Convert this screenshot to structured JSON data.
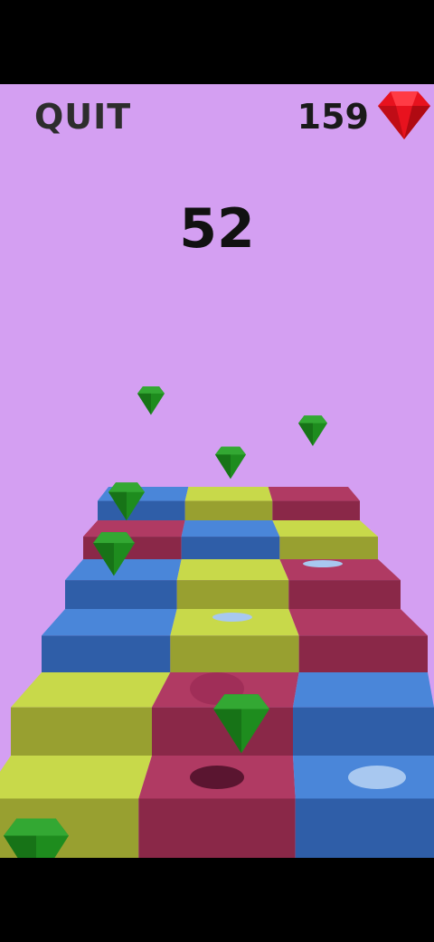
{
  "hud": {
    "quit_label": "QUIT",
    "gem_count": "159",
    "score": "52",
    "gem_icon": "red-diamond-icon"
  },
  "colors": {
    "background": "#d49ff2",
    "yellow_top": "#c8d94a",
    "yellow_side": "#98a030",
    "red_top": "#b03a63",
    "red_side": "#8a2848",
    "blue_top": "#4a86d9",
    "blue_side": "#2f5ea8",
    "gem_green": "#1e8c1e",
    "gem_red": "#e8121e"
  },
  "stairs": {
    "rows": [
      [
        "yellow",
        "red",
        "blue"
      ],
      [
        "yellow",
        "red",
        "blue"
      ],
      [
        "blue",
        "yellow",
        "red"
      ],
      [
        "blue",
        "yellow",
        "red"
      ],
      [
        "red",
        "blue",
        "yellow"
      ],
      [
        "blue",
        "yellow",
        "red"
      ]
    ]
  }
}
